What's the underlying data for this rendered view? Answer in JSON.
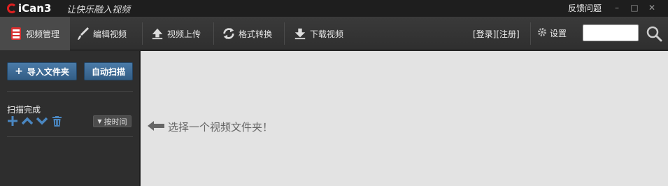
{
  "titlebar": {
    "logo_text": "iCan3",
    "slogan": "让快乐融入视频",
    "feedback": "反馈问题",
    "minimize": "–",
    "maximize": "□",
    "close": "✕"
  },
  "toolbar": {
    "tabs": [
      {
        "label": "视频管理",
        "icon": "film-icon"
      },
      {
        "label": "编辑视频",
        "icon": "brush-icon"
      },
      {
        "label": "视频上传",
        "icon": "upload-icon"
      },
      {
        "label": "格式转换",
        "icon": "convert-icon"
      },
      {
        "label": "下载视频",
        "icon": "download-icon"
      }
    ],
    "login": "[登录][注册]",
    "settings": "设置",
    "search_value": ""
  },
  "sidebar": {
    "import_label": "导入文件夹",
    "auto_scan_label": "自动扫描",
    "scan_status": "扫描完成",
    "sort_label": "按时间"
  },
  "main": {
    "hint": "选择一个视频文件夹！"
  },
  "colors": {
    "accent_red": "#e02020",
    "button_blue": "#3d6c98",
    "main_bg": "#e3e3e3"
  }
}
